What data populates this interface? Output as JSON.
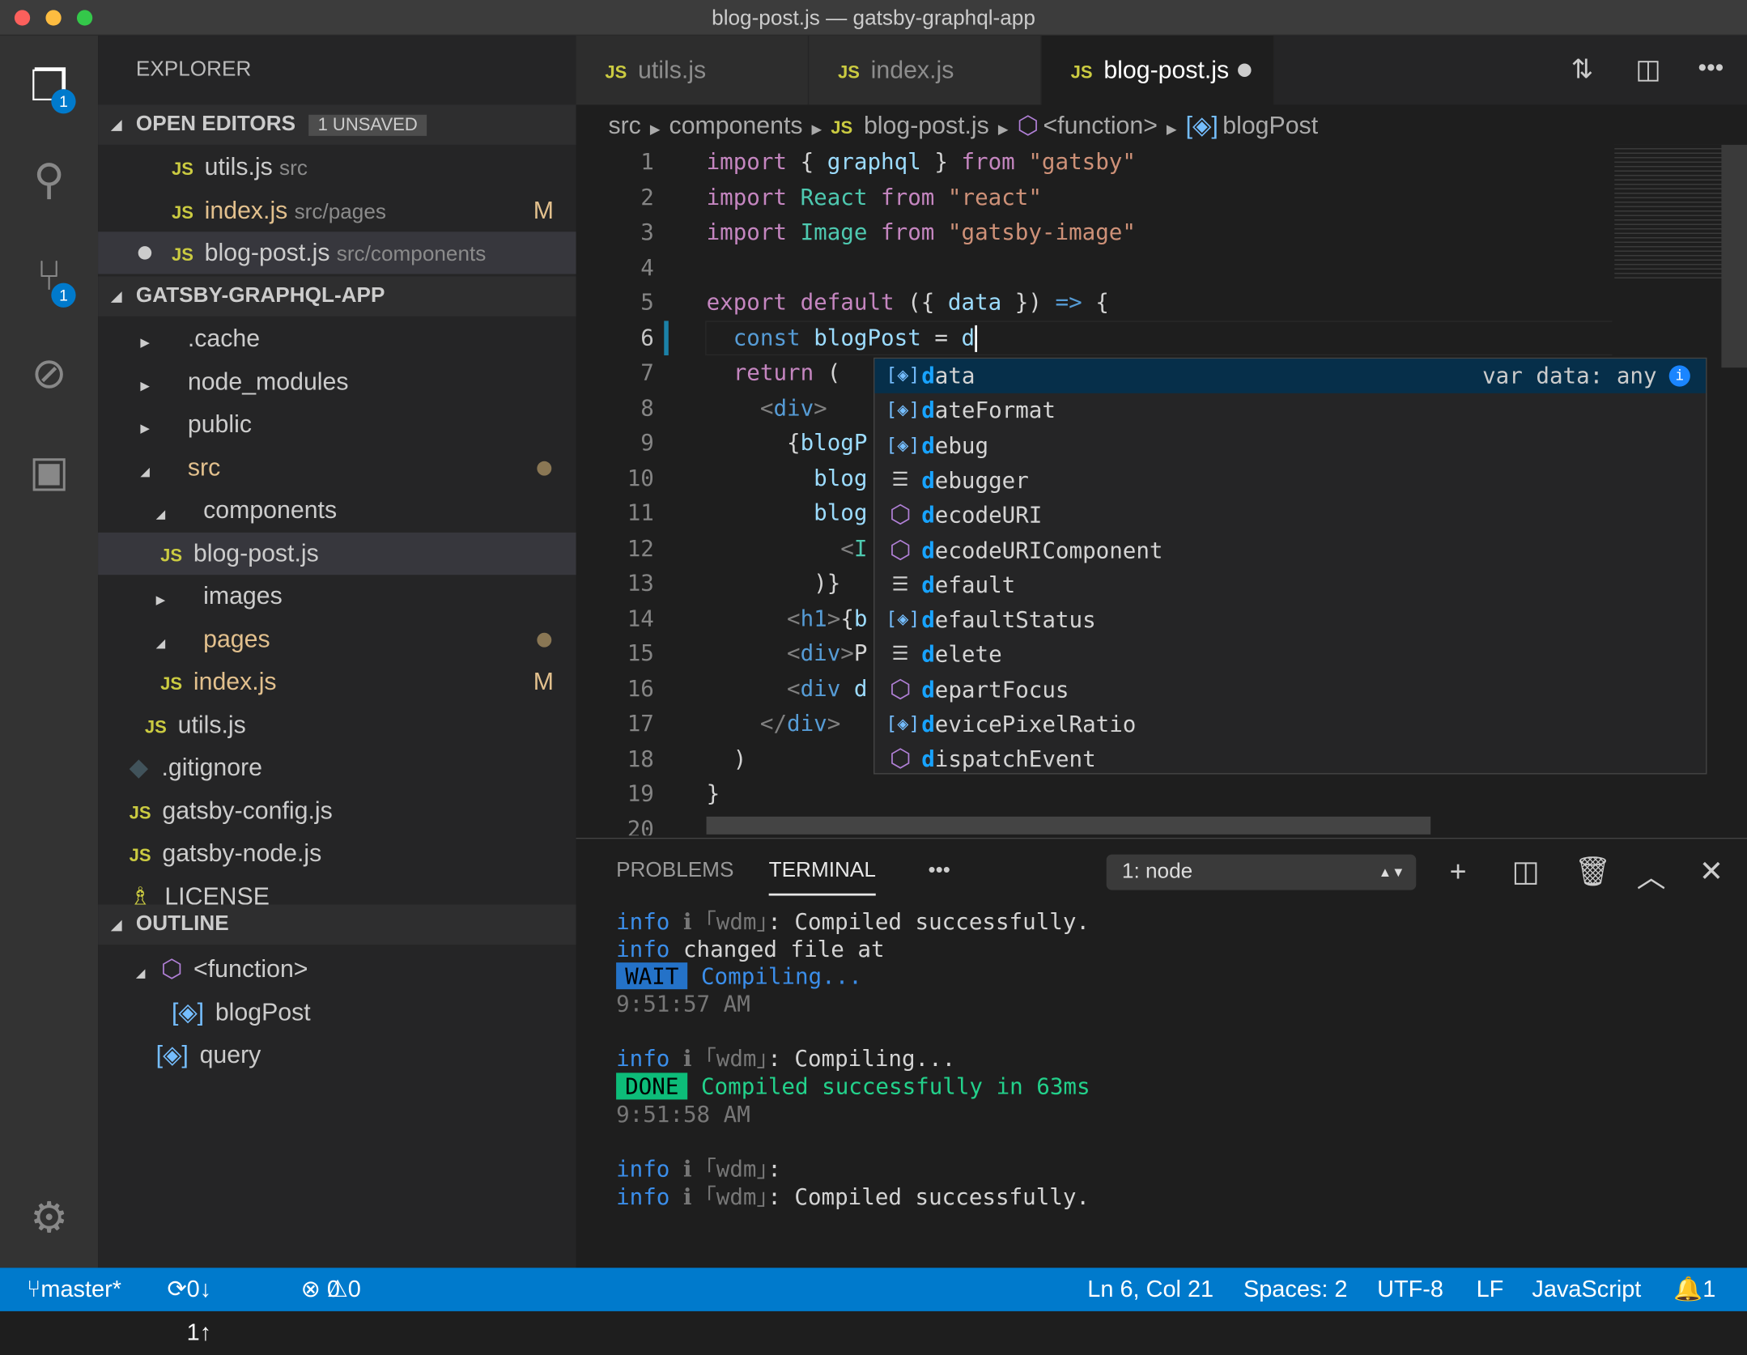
{
  "window": {
    "title": "blog-post.js — gatsby-graphql-app"
  },
  "activity": {
    "explorer_badge": "1",
    "scm_badge": "1"
  },
  "sidebar": {
    "explorer_label": "EXPLORER",
    "open_editors": {
      "label": "OPEN EDITORS",
      "badge": "1 UNSAVED",
      "items": [
        {
          "name": "utils.js",
          "path": "src",
          "status": ""
        },
        {
          "name": "index.js",
          "path": "src/pages",
          "status": "M"
        },
        {
          "name": "blog-post.js",
          "path": "src/components",
          "status": "unsaved"
        }
      ]
    },
    "project": {
      "label": "GATSBY-GRAPHQL-APP",
      "items": [
        {
          "name": ".cache"
        },
        {
          "name": "node_modules"
        },
        {
          "name": "public"
        },
        {
          "name": "src"
        },
        {
          "name": "components"
        },
        {
          "name": "blog-post.js"
        },
        {
          "name": "images"
        },
        {
          "name": "pages"
        },
        {
          "name": "index.js",
          "status": "M"
        },
        {
          "name": "utils.js"
        },
        {
          "name": ".gitignore"
        },
        {
          "name": "gatsby-config.js"
        },
        {
          "name": "gatsby-node.js"
        },
        {
          "name": "LICENSE"
        }
      ]
    },
    "outline": {
      "label": "OUTLINE",
      "items": [
        {
          "name": "<function>"
        },
        {
          "name": "blogPost"
        },
        {
          "name": "query"
        }
      ]
    }
  },
  "tabs": [
    {
      "label": "utils.js",
      "icon": "JS"
    },
    {
      "label": "index.js",
      "icon": "JS"
    },
    {
      "label": "blog-post.js",
      "icon": "JS"
    }
  ],
  "breadcrumb": [
    "src",
    "components",
    "blog-post.js",
    "<function>",
    "blogPost"
  ],
  "editor": {
    "lines": [
      [
        [
          "kw",
          "import"
        ],
        [
          "pl",
          " { "
        ],
        [
          "id",
          "graphql"
        ],
        [
          "pl",
          " } "
        ],
        [
          "kw",
          "from"
        ],
        [
          "pl",
          " "
        ],
        [
          "str",
          "\"gatsby\""
        ]
      ],
      [
        [
          "kw",
          "import"
        ],
        [
          "pl",
          " "
        ],
        [
          "ty",
          "React"
        ],
        [
          "pl",
          " "
        ],
        [
          "kw",
          "from"
        ],
        [
          "pl",
          " "
        ],
        [
          "str",
          "\"react\""
        ]
      ],
      [
        [
          "kw",
          "import"
        ],
        [
          "pl",
          " "
        ],
        [
          "ty",
          "Image"
        ],
        [
          "pl",
          " "
        ],
        [
          "kw",
          "from"
        ],
        [
          "pl",
          " "
        ],
        [
          "str",
          "\"gatsby-image\""
        ]
      ],
      [],
      [
        [
          "kw",
          "export"
        ],
        [
          "pl",
          " "
        ],
        [
          "kw",
          "default"
        ],
        [
          "pl",
          " ({ "
        ],
        [
          "id",
          "data"
        ],
        [
          "pl",
          " }) "
        ],
        [
          "dk",
          "=>"
        ],
        [
          "pl",
          " {"
        ]
      ],
      [
        [
          "pl",
          "  "
        ],
        [
          "dk",
          "const"
        ],
        [
          "pl",
          " "
        ],
        [
          "id",
          "blogPost"
        ],
        [
          "pl",
          " = "
        ],
        [
          "id",
          "d"
        ]
      ],
      [
        [
          "pl",
          "  "
        ],
        [
          "kw",
          "return"
        ],
        [
          "pl",
          " ("
        ]
      ],
      [
        [
          "pl",
          "    "
        ],
        [
          "tg",
          "<"
        ],
        [
          "dk",
          "div"
        ],
        [
          "tg",
          ">"
        ]
      ],
      [
        [
          "pl",
          "      {"
        ],
        [
          "id",
          "blogP"
        ]
      ],
      [
        [
          "pl",
          "        "
        ],
        [
          "id",
          "blog"
        ]
      ],
      [
        [
          "pl",
          "        "
        ],
        [
          "id",
          "blog"
        ]
      ],
      [
        [
          "pl",
          "          "
        ],
        [
          "tg",
          "<"
        ],
        [
          "ty",
          "I"
        ]
      ],
      [
        [
          "pl",
          "        )}"
        ]
      ],
      [
        [
          "pl",
          "      "
        ],
        [
          "tg",
          "<"
        ],
        [
          "dk",
          "h1"
        ],
        [
          "tg",
          ">"
        ],
        [
          "pl",
          "{"
        ],
        [
          "id",
          "b"
        ]
      ],
      [
        [
          "pl",
          "      "
        ],
        [
          "tg",
          "<"
        ],
        [
          "dk",
          "div"
        ],
        [
          "tg",
          ">"
        ],
        [
          "pl",
          "P"
        ]
      ],
      [
        [
          "pl",
          "      "
        ],
        [
          "tg",
          "<"
        ],
        [
          "dk",
          "div"
        ],
        [
          "pl",
          " "
        ],
        [
          "id",
          "d"
        ]
      ],
      [
        [
          "pl",
          "    "
        ],
        [
          "tg",
          "</"
        ],
        [
          "dk",
          "div"
        ],
        [
          "tg",
          ">"
        ]
      ],
      [
        [
          "pl",
          "  )"
        ]
      ],
      [
        [
          "pl",
          "}"
        ]
      ],
      []
    ],
    "suggestions": [
      {
        "match": "d",
        "rest": "ata",
        "kind": "variable",
        "detail": "var data: any"
      },
      {
        "match": "d",
        "rest": "ateFormat",
        "kind": "variable"
      },
      {
        "match": "d",
        "rest": "ebug",
        "kind": "variable"
      },
      {
        "match": "d",
        "rest": "ebugger",
        "kind": "keyword"
      },
      {
        "match": "d",
        "rest": "ecodeURI",
        "kind": "function"
      },
      {
        "match": "d",
        "rest": "ecodeURIComponent",
        "kind": "function"
      },
      {
        "match": "d",
        "rest": "efault",
        "kind": "keyword"
      },
      {
        "match": "d",
        "rest": "efaultStatus",
        "kind": "variable"
      },
      {
        "match": "d",
        "rest": "elete",
        "kind": "keyword"
      },
      {
        "match": "d",
        "rest": "epartFocus",
        "kind": "function"
      },
      {
        "match": "d",
        "rest": "evicePixelRatio",
        "kind": "variable"
      },
      {
        "match": "d",
        "rest": "ispatchEvent",
        "kind": "function"
      }
    ]
  },
  "panel": {
    "tabs": [
      "PROBLEMS",
      "TERMINAL"
    ],
    "more": "•••",
    "terminal_select": "1: node",
    "terminal": [
      [
        [
          "info",
          "info"
        ],
        [
          "gray",
          " ℹ ｢wdm｣"
        ],
        [
          "pl",
          ": Compiled successfully."
        ]
      ],
      [
        [
          "info",
          "info"
        ],
        [
          "pl",
          " changed file at"
        ]
      ],
      [
        [
          "wait",
          "WAIT"
        ],
        [
          "blue",
          " Compiling..."
        ]
      ],
      [
        [
          "gray",
          "9:51:57 AM"
        ]
      ],
      [],
      [
        [
          "info",
          "info"
        ],
        [
          "gray",
          " ℹ ｢wdm｣"
        ],
        [
          "pl",
          ": Compiling..."
        ]
      ],
      [
        [
          "done",
          "DONE"
        ],
        [
          "green",
          " Compiled successfully in 63ms"
        ]
      ],
      [
        [
          "gray",
          "9:51:58 AM"
        ]
      ],
      [],
      [
        [
          "info",
          "info"
        ],
        [
          "gray",
          " ℹ ｢wdm｣"
        ],
        [
          "pl",
          ":"
        ]
      ],
      [
        [
          "info",
          "info"
        ],
        [
          "gray",
          " ℹ ｢wdm｣"
        ],
        [
          "pl",
          ": Compiled successfully."
        ]
      ]
    ]
  },
  "status": {
    "branch": "master*",
    "sync": "0↓ 1↑",
    "errors": "0",
    "warnings": "0",
    "position": "Ln 6, Col 21",
    "spaces": "Spaces: 2",
    "encoding": "UTF-8",
    "eol": "LF",
    "language": "JavaScript",
    "notifications": "1"
  }
}
